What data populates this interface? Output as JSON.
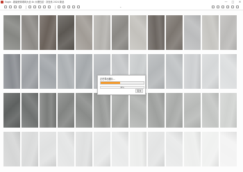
{
  "window": {
    "title": "Eagle - 超级瓷砖墙砖大全 4k 大理石纹 · 灰色系 2024 新品",
    "controls": [
      "—",
      "□",
      "✕"
    ]
  },
  "toolbar": {
    "left_icons": [
      "back-icon",
      "forward-icon",
      "refresh-icon",
      "home-icon",
      "folder-icon",
      "image-icon",
      "grid-icon",
      "list-icon",
      "zoom-icon",
      "crop-icon",
      "rotate-icon",
      "flip-icon",
      "info-icon",
      "tag-icon"
    ],
    "center_glyph": "⌄",
    "right_icons": [
      "share-icon",
      "star-icon",
      "window-icon",
      "menu-icon",
      "fullscreen-icon",
      "settings-icon"
    ]
  },
  "dialog": {
    "title": "正在导出图片...",
    "progress_fraction": 0.45,
    "progress_text": "45%",
    "cancel_label": "取消",
    "accent_color": "#f29a2e"
  },
  "tile_rows": [
    [
      "#868783",
      "#8d8a86",
      "#6b625b",
      "#5c5853",
      "#a19c96",
      "#b4b2ae",
      "#8b8985",
      "#c3c1bc",
      "#6c6661",
      "#7c7670",
      "#bbbcbd",
      "#c6c5c1",
      "#bcbbb9"
    ],
    [
      "#8a8d92",
      "#9c9fa3",
      "#a2a6aa",
      "#acb0b3",
      "#a5a9ac",
      "#b7babd",
      "#c4c6c8",
      "#c9cccd",
      "#b4b7b9",
      "#bfc2c4",
      "#cdcfd1",
      "#d5d7d8",
      "#dcdedf"
    ],
    [
      "#5e6160",
      "#6f7271",
      "#7b7d7b",
      "#828482",
      "#8a8c8a",
      "#999b99",
      "#a7a9a7",
      "#b1b3b1",
      "#9fa19f",
      "#a9aba9",
      "#b8bab8",
      "#c3c5c3",
      "#d1d3d1"
    ],
    [
      "#d5d6d6",
      "#dadbdb",
      "#e0e1e1",
      "#e4e5e5",
      "#dfe0e0",
      "#e6e7e7",
      "#e9eaea",
      "#ecedec",
      "#e3e4e4",
      "#e8e9e9",
      "#edeeed",
      "#f0f1f0",
      "#f3f3f3"
    ]
  ]
}
